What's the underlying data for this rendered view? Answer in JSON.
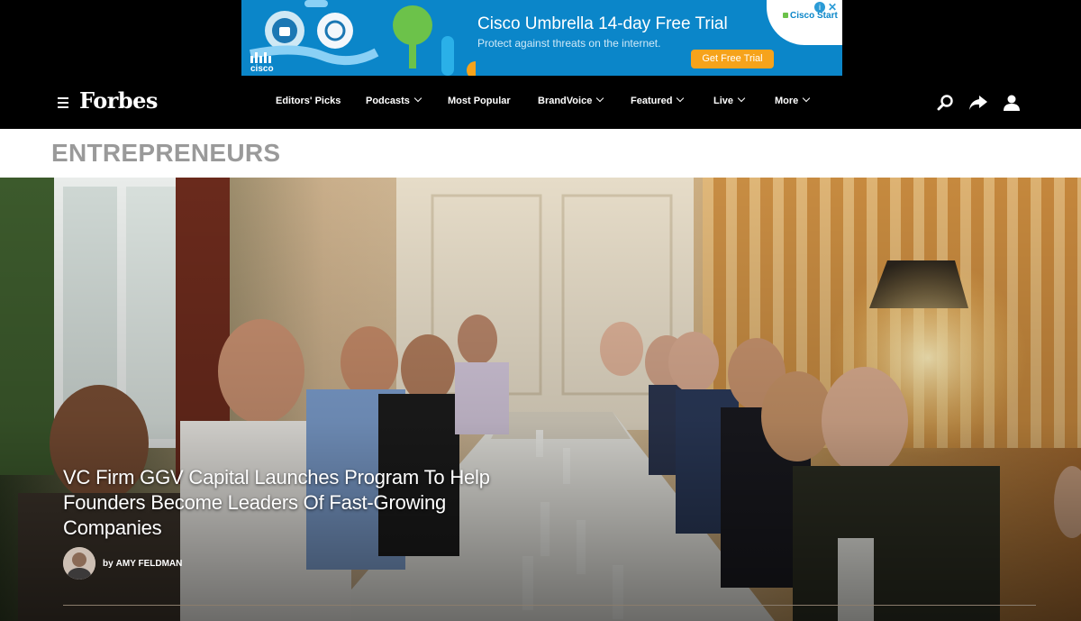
{
  "ad": {
    "headline": "Cisco Umbrella 14-day Free Trial",
    "subline": "Protect against threats on the internet.",
    "cta": "Get Free Trial",
    "brand_logo": "cisco",
    "partner_logo": "Cisco Start",
    "info_icon": "info-icon",
    "close_icon": "close-icon",
    "colors": {
      "background": "#0b86c9",
      "cta": "#f6a31b"
    }
  },
  "nav": {
    "brand": "Forbes",
    "menu_icon": "hamburger-menu-icon",
    "items": [
      {
        "label": "Editors' Picks",
        "dropdown": false
      },
      {
        "label": "Podcasts",
        "dropdown": true
      },
      {
        "label": "Most Popular",
        "dropdown": false
      },
      {
        "label": "BrandVoice",
        "dropdown": true
      },
      {
        "label": "Featured",
        "dropdown": true
      },
      {
        "label": "Live",
        "dropdown": true
      },
      {
        "label": "More",
        "dropdown": true
      }
    ],
    "actions": [
      "search-icon",
      "share-icon",
      "user-icon"
    ]
  },
  "channel": {
    "title": "ENTREPRENEURS"
  },
  "hero": {
    "headline": "VC Firm GGV Capital Launches Program To Help Founders Become Leaders Of Fast-Growing Companies",
    "byline_prefix": "by",
    "author": "AMY FELDMAN"
  }
}
